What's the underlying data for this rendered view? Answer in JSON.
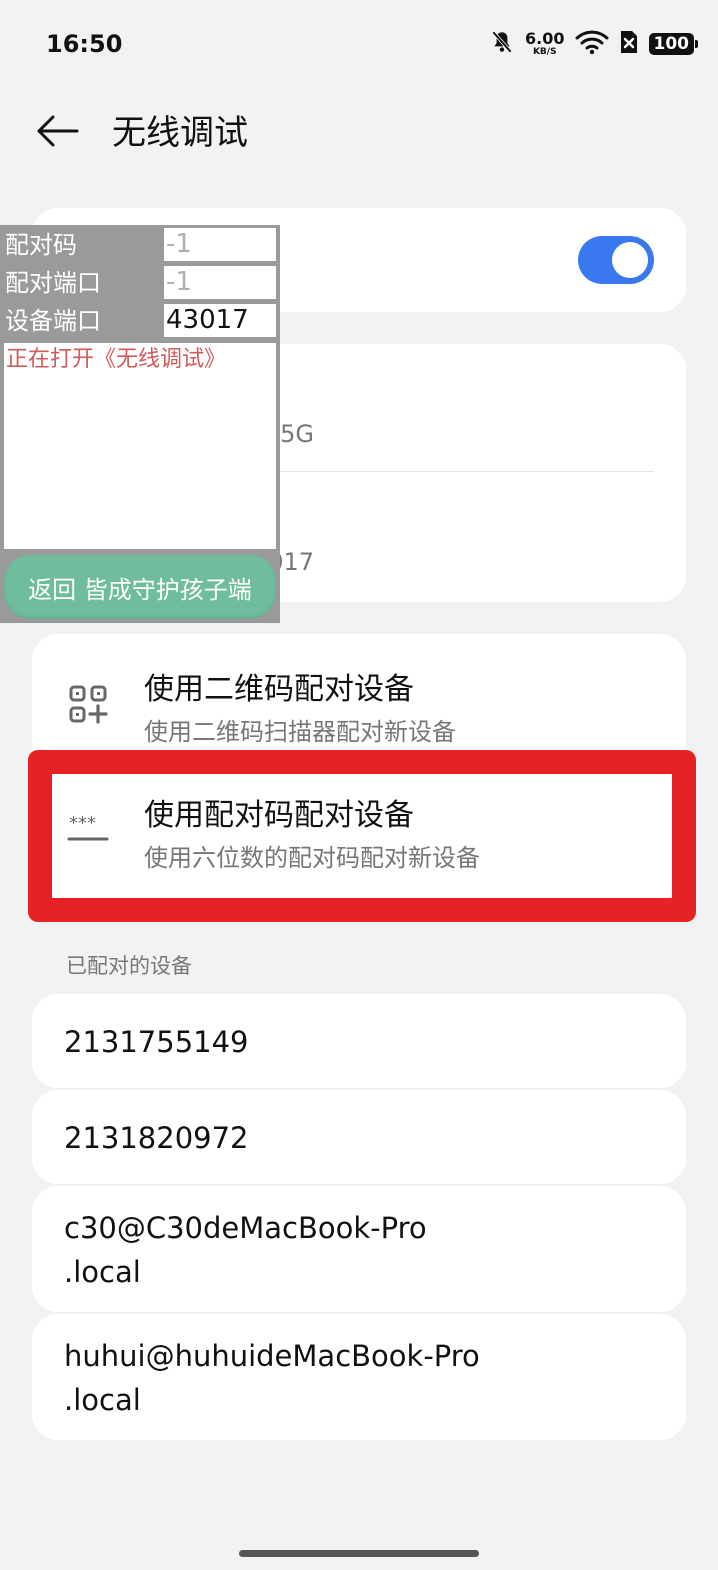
{
  "status_bar": {
    "time": "16:50",
    "net_speed_value": "6.00",
    "net_speed_unit": "KB/S",
    "battery": "100",
    "icons": [
      "bell-muted-icon",
      "wifi-icon",
      "no-sim-icon",
      "battery-icon"
    ]
  },
  "header": {
    "title": "无线调试",
    "back_icon": "arrow-left-icon"
  },
  "toggle": {
    "state": "on",
    "color": "#3a78f0"
  },
  "info": {
    "row1_value": "5G",
    "row2_value": "3017"
  },
  "pairing": [
    {
      "title": "使用二维码配对设备",
      "subtitle": "使用二维码扫描器配对新设备",
      "icon": "qr-code-icon"
    },
    {
      "title": "使用配对码配对设备",
      "subtitle": "使用六位数的配对码配对新设备",
      "icon": "password-dots-icon"
    }
  ],
  "paired_section_label": "已配对的设备",
  "devices": [
    {
      "line1": "2131755149",
      "line2": ""
    },
    {
      "line1": "2131820972",
      "line2": ""
    },
    {
      "line1": "c30@C30deMacBook-Pro",
      "line2": ".local"
    },
    {
      "line1": "huhui@huhuideMacBook-Pro",
      "line2": ".local"
    }
  ],
  "overlay": {
    "pair_code_label": "配对码",
    "pair_code_value": "-1",
    "pair_port_label": "配对端口",
    "pair_port_value": "-1",
    "device_port_label": "设备端口",
    "device_port_value": "43017",
    "log_text": "正在打开《无线调试》",
    "back_button": "返回 皆成守护孩子端"
  },
  "colors": {
    "highlight": "#e62226",
    "accent": "#3a78f0",
    "overlay_button": "#6fbd9d",
    "log_text": "#d35a5a"
  }
}
